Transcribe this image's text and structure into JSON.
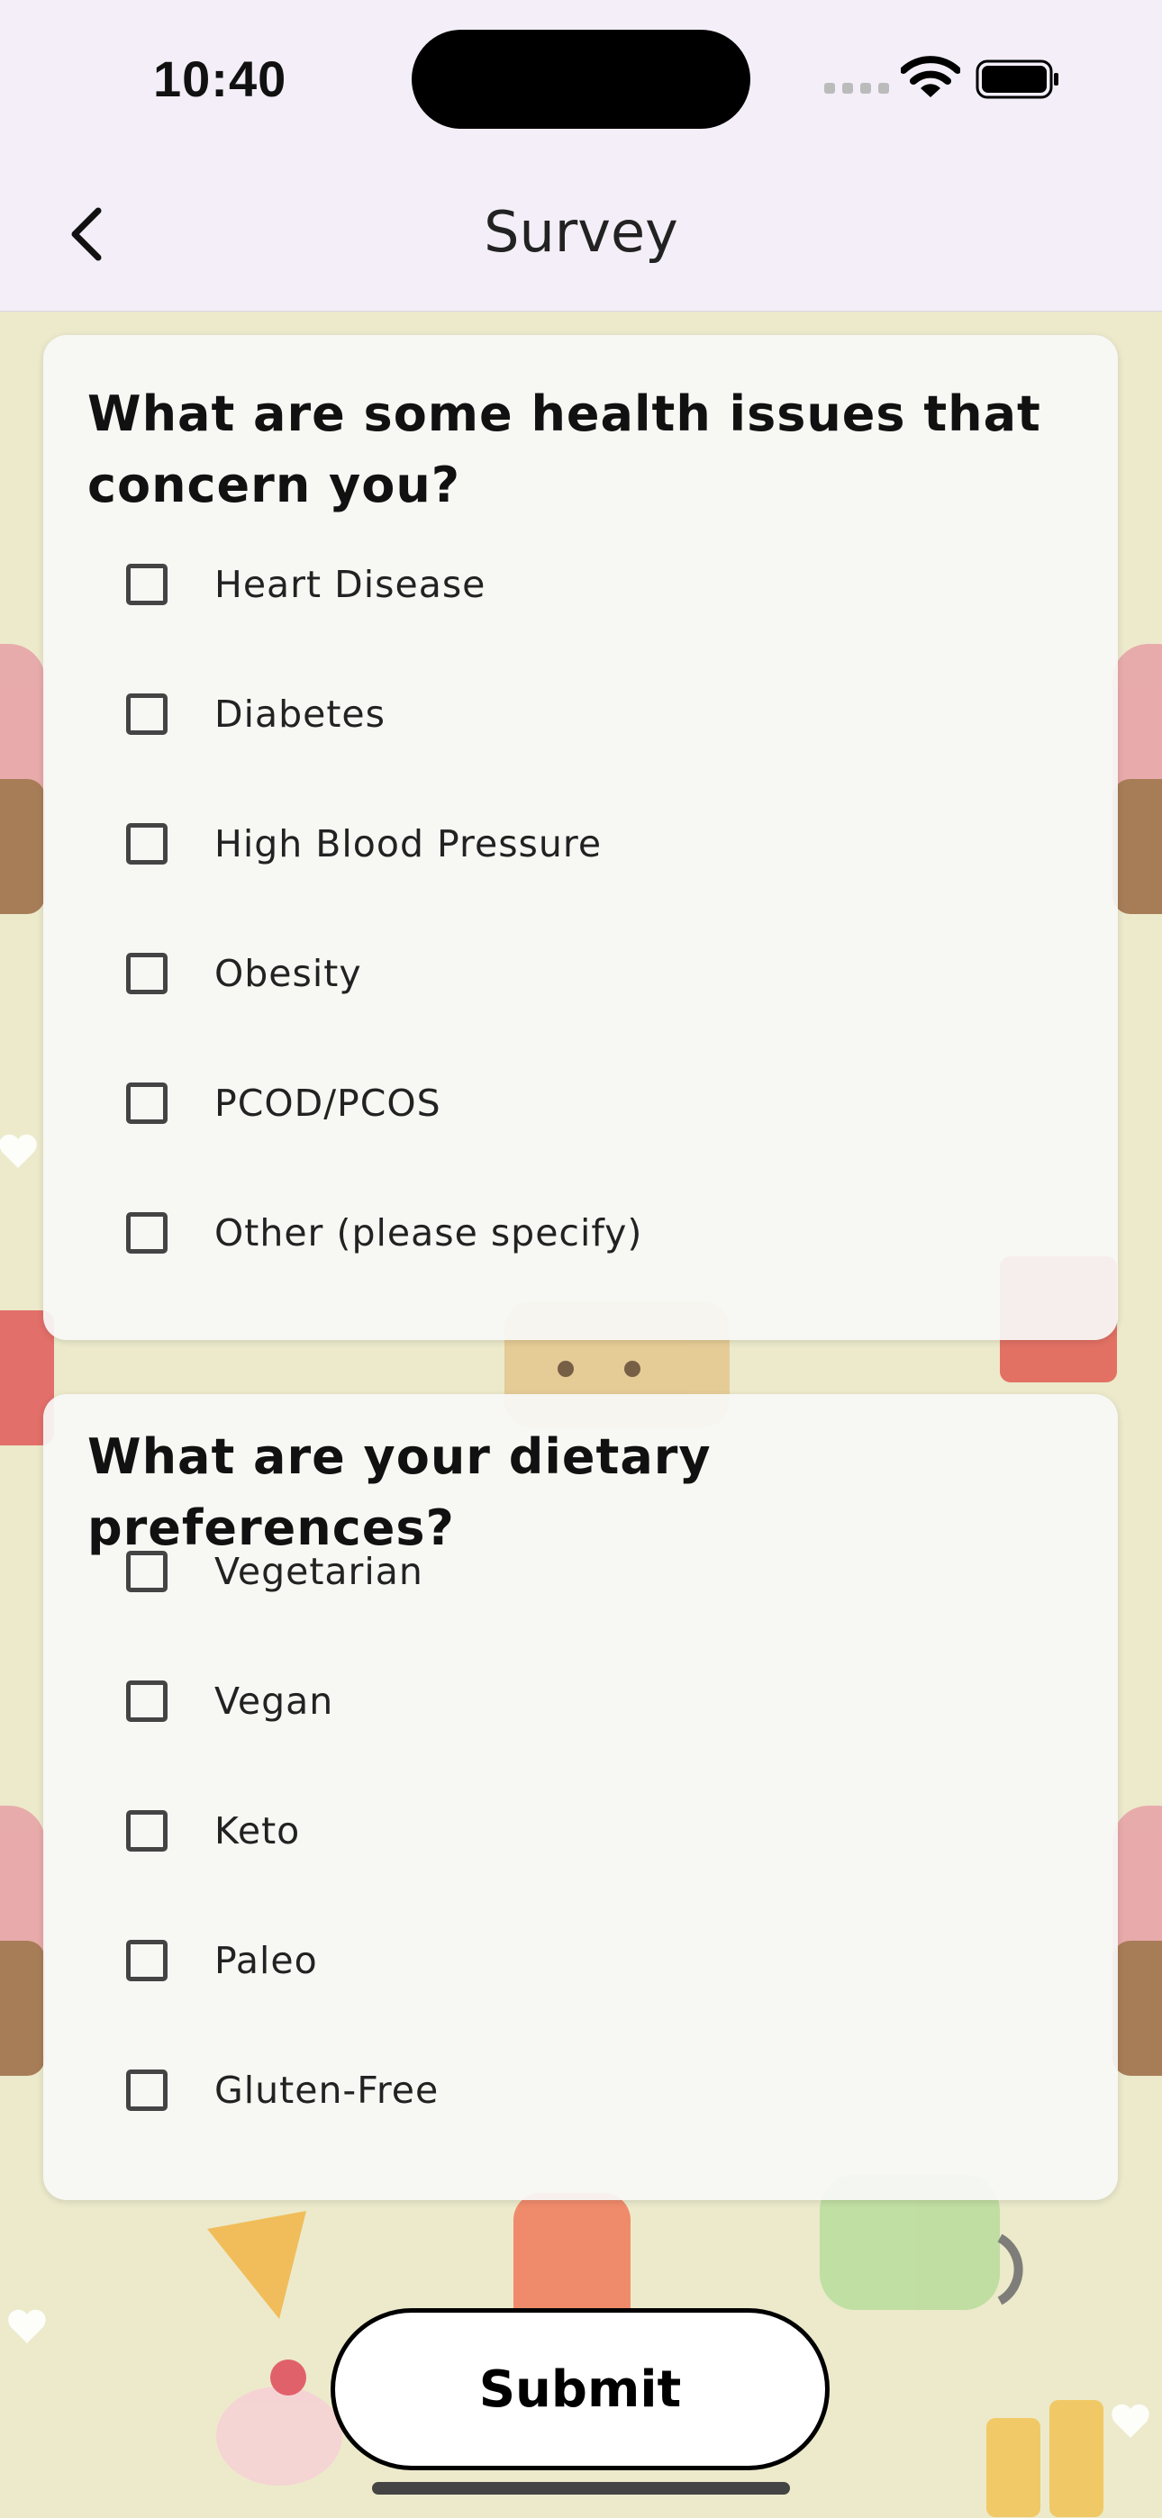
{
  "status_bar": {
    "time": "10:40",
    "icons": [
      "signal-icon",
      "wifi-icon",
      "battery-icon"
    ]
  },
  "nav": {
    "title": "Survey",
    "back_icon": "chevron-left-icon"
  },
  "questions": [
    {
      "text": "What are some health issues that concern you?",
      "options": [
        {
          "label": "Heart Disease",
          "checked": false
        },
        {
          "label": "Diabetes",
          "checked": false
        },
        {
          "label": "High Blood Pressure",
          "checked": false
        },
        {
          "label": "Obesity",
          "checked": false
        },
        {
          "label": "PCOD/PCOS",
          "checked": false
        },
        {
          "label": "Other (please specify)",
          "checked": false
        }
      ]
    },
    {
      "text": "What are your dietary preferences?",
      "options": [
        {
          "label": "Vegetarian",
          "checked": false
        },
        {
          "label": "Vegan",
          "checked": false
        },
        {
          "label": "Keto",
          "checked": false
        },
        {
          "label": "Paleo",
          "checked": false
        },
        {
          "label": "Gluten-Free",
          "checked": false
        }
      ]
    }
  ],
  "submit_label": "Submit",
  "colors": {
    "header_bg": "#f3eef7",
    "page_bg": "#eceacb",
    "card_bg": "#f8f8f6",
    "checkbox_border": "#444444"
  }
}
